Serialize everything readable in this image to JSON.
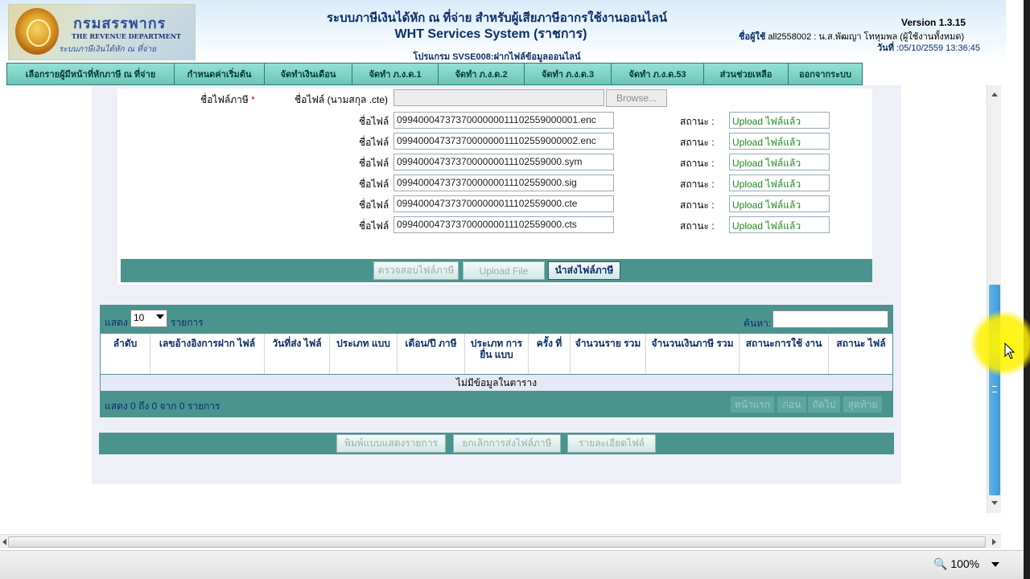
{
  "header": {
    "logo": {
      "thai": "กรมสรรพากร",
      "english": "THE REVENUE DEPARTMENT",
      "sub": "ระบบภาษีเงินได้หัก ณ ที่จ่าย"
    },
    "title_line1": "ระบบภาษีเงินได้หัก ณ ที่จ่าย สำหรับผู้เสียภาษีอากรใช้งานออนไลน์",
    "title_line2": "WHT Services System  (ราชการ)",
    "program": "โปรแกรม SVSE008:ฝากไฟล์ข้อมูลออนไลน์",
    "version": "Version 1.3.15",
    "user_label": "ชื่อผู้ใช้",
    "user_value": "all2558002 : น.ส.พัฒญา โทหุมพล   (ผู้ใช้งานทั้งหมด)",
    "date_label": "วันที่",
    "date_value": ":05/10/2559 13:36:45"
  },
  "nav": [
    "เลือกรายผู้มีหน้าที่หักภาษี ณ ที่จ่าย",
    "กำหนดค่าเริ่มต้น",
    "จัดทำเงินเดือน",
    "จัดทำ ภ.ง.ด.1",
    "จัดทำ ภ.ง.ด.2",
    "จัดทำ ภ.ง.ด.3",
    "จัดทำ ภ.ง.ด.53",
    "ส่วนช่วยเหลือ",
    "ออกจากระบบ"
  ],
  "form": {
    "tax_file_label": "ชื่อไฟล์ภาษี",
    "required_mark": "*",
    "file_ext_label": "ชื่อไฟล์ (นามสกุล .cte)",
    "browse_label": "Browse...",
    "file_label": "ชื่อไฟล์",
    "status_label": "สถานะ :",
    "files": [
      {
        "name": "0994000473737000000011102559000001.enc",
        "status": "Upload ไฟล์แล้ว"
      },
      {
        "name": "0994000473737000000011102559000002.enc",
        "status": "Upload ไฟล์แล้ว"
      },
      {
        "name": "0994000473737000000011102559000.sym",
        "status": "Upload ไฟล์แล้ว"
      },
      {
        "name": "0994000473737000000011102559000.sig",
        "status": "Upload ไฟล์แล้ว"
      },
      {
        "name": "0994000473737000000011102559000.cte",
        "status": "Upload ไฟล์แล้ว"
      },
      {
        "name": "0994000473737000000011102559000.cts",
        "status": "Upload ไฟล์แล้ว"
      }
    ],
    "buttons": {
      "check": "ตรวจสอบไฟล์ภาษี",
      "upload": "Upload File",
      "submit": "นำส่งไฟล์ภาษี"
    }
  },
  "table": {
    "show_label": "แสดง",
    "page_size": "10",
    "items_label": "รายการ",
    "search_label": "ค้นหา:",
    "columns": [
      "ลำดับ",
      "เลขอ้างอิงการฝาก ไฟล์",
      "วันที่ส่ง ไฟล์",
      "ประเภท แบบ",
      "เดือน/ปี ภาษี",
      "ประเภท การยื่น แบบ",
      "ครั้ง ที่",
      "จำนวนราย รวม",
      "จำนวนเงินภาษี รวม",
      "สถานะการใช้ งาน",
      "สถานะ ไฟล์"
    ],
    "empty_text": "ไม่มีข้อมูลในตาราง",
    "info": "แสดง 0 ถึง 0 จาก 0 รายการ",
    "pager": {
      "first": "หน้าแรก",
      "prev": "ก่อน",
      "next": "ถัดไป",
      "last": "สุดท้าย"
    }
  },
  "bottom_buttons": {
    "print": "พิมพ์แบบแสดงรายการ",
    "cancel": "ยกเลิกการส่งไฟล์ภาษี",
    "detail": "รายละเอียดไฟล์"
  },
  "statusbar": {
    "zoom": "100%"
  },
  "colors": {
    "teal": "#4a9490",
    "nav": "#6bc5b7",
    "title": "#0b2f6a",
    "status_green": "#1f8a1f"
  }
}
